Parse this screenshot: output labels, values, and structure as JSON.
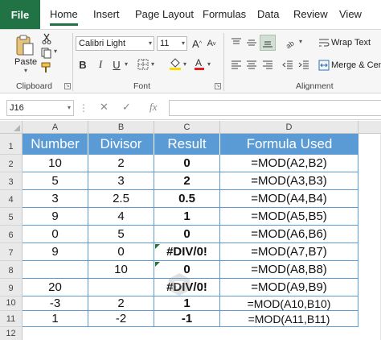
{
  "tabs": {
    "file": "File",
    "items": [
      "Home",
      "Insert",
      "Page Layout",
      "Formulas",
      "Data",
      "Review",
      "View"
    ],
    "active": "Home"
  },
  "ribbon": {
    "clipboard": {
      "paste": "Paste",
      "label": "Clipboard"
    },
    "font": {
      "name": "Calibri Light",
      "size": "11",
      "bold": "B",
      "italic": "I",
      "underline": "U",
      "grow": "A",
      "shrink": "A",
      "label": "Font"
    },
    "alignment": {
      "wrap_text": "Wrap Text",
      "merge": "Merge & Cen",
      "label": "Alignment"
    }
  },
  "formula_bar": {
    "name_box": "J16",
    "fx": "fx",
    "formula": ""
  },
  "grid": {
    "columns": [
      "A",
      "B",
      "C",
      "D"
    ],
    "rows": [
      "1",
      "2",
      "3",
      "4",
      "5",
      "6",
      "7",
      "8",
      "9",
      "10",
      "11",
      "12"
    ],
    "header": [
      "Number",
      "Divisor",
      "Result",
      "Formula Used"
    ],
    "data": [
      [
        "10",
        "2",
        "0",
        "=MOD(A2,B2)"
      ],
      [
        "5",
        "3",
        "2",
        "=MOD(A3,B3)"
      ],
      [
        "3",
        "2.5",
        "0.5",
        "=MOD(A4,B4)"
      ],
      [
        "9",
        "4",
        "1",
        "=MOD(A5,B5)"
      ],
      [
        "0",
        "5",
        "0",
        "=MOD(A6,B6)"
      ],
      [
        "9",
        "0",
        "#DIV/0!",
        "=MOD(A7,B7)"
      ],
      [
        "",
        "10",
        "0",
        "=MOD(A8,B8)"
      ],
      [
        "20",
        "",
        "#DIV/0!",
        "=MOD(A9,B9)"
      ],
      [
        "-3",
        "2",
        "1",
        "=MOD(A10,B10)"
      ],
      [
        "1",
        "-2",
        "-1",
        "=MOD(A11,B11)"
      ]
    ]
  },
  "colors": {
    "excel_green": "#217346",
    "header_blue": "#5b9bd5"
  }
}
